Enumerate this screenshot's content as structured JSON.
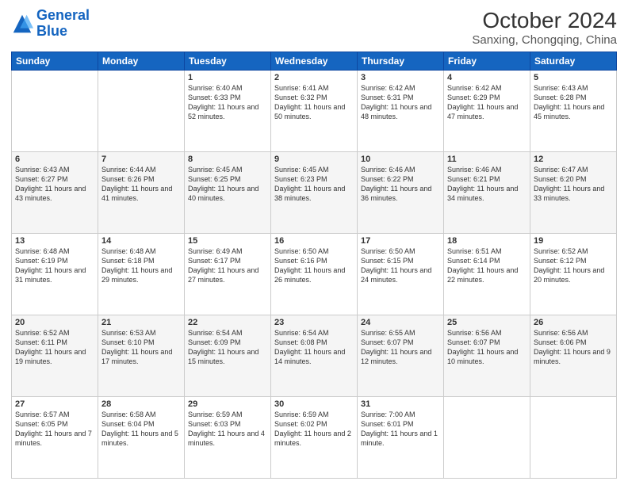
{
  "logo": {
    "line1": "General",
    "line2": "Blue"
  },
  "title": "October 2024",
  "subtitle": "Sanxing, Chongqing, China",
  "days": [
    "Sunday",
    "Monday",
    "Tuesday",
    "Wednesday",
    "Thursday",
    "Friday",
    "Saturday"
  ],
  "weeks": [
    [
      {
        "day": "",
        "content": ""
      },
      {
        "day": "",
        "content": ""
      },
      {
        "day": "1",
        "content": "Sunrise: 6:40 AM\nSunset: 6:33 PM\nDaylight: 11 hours and 52 minutes."
      },
      {
        "day": "2",
        "content": "Sunrise: 6:41 AM\nSunset: 6:32 PM\nDaylight: 11 hours and 50 minutes."
      },
      {
        "day": "3",
        "content": "Sunrise: 6:42 AM\nSunset: 6:31 PM\nDaylight: 11 hours and 48 minutes."
      },
      {
        "day": "4",
        "content": "Sunrise: 6:42 AM\nSunset: 6:29 PM\nDaylight: 11 hours and 47 minutes."
      },
      {
        "day": "5",
        "content": "Sunrise: 6:43 AM\nSunset: 6:28 PM\nDaylight: 11 hours and 45 minutes."
      }
    ],
    [
      {
        "day": "6",
        "content": "Sunrise: 6:43 AM\nSunset: 6:27 PM\nDaylight: 11 hours and 43 minutes."
      },
      {
        "day": "7",
        "content": "Sunrise: 6:44 AM\nSunset: 6:26 PM\nDaylight: 11 hours and 41 minutes."
      },
      {
        "day": "8",
        "content": "Sunrise: 6:45 AM\nSunset: 6:25 PM\nDaylight: 11 hours and 40 minutes."
      },
      {
        "day": "9",
        "content": "Sunrise: 6:45 AM\nSunset: 6:23 PM\nDaylight: 11 hours and 38 minutes."
      },
      {
        "day": "10",
        "content": "Sunrise: 6:46 AM\nSunset: 6:22 PM\nDaylight: 11 hours and 36 minutes."
      },
      {
        "day": "11",
        "content": "Sunrise: 6:46 AM\nSunset: 6:21 PM\nDaylight: 11 hours and 34 minutes."
      },
      {
        "day": "12",
        "content": "Sunrise: 6:47 AM\nSunset: 6:20 PM\nDaylight: 11 hours and 33 minutes."
      }
    ],
    [
      {
        "day": "13",
        "content": "Sunrise: 6:48 AM\nSunset: 6:19 PM\nDaylight: 11 hours and 31 minutes."
      },
      {
        "day": "14",
        "content": "Sunrise: 6:48 AM\nSunset: 6:18 PM\nDaylight: 11 hours and 29 minutes."
      },
      {
        "day": "15",
        "content": "Sunrise: 6:49 AM\nSunset: 6:17 PM\nDaylight: 11 hours and 27 minutes."
      },
      {
        "day": "16",
        "content": "Sunrise: 6:50 AM\nSunset: 6:16 PM\nDaylight: 11 hours and 26 minutes."
      },
      {
        "day": "17",
        "content": "Sunrise: 6:50 AM\nSunset: 6:15 PM\nDaylight: 11 hours and 24 minutes."
      },
      {
        "day": "18",
        "content": "Sunrise: 6:51 AM\nSunset: 6:14 PM\nDaylight: 11 hours and 22 minutes."
      },
      {
        "day": "19",
        "content": "Sunrise: 6:52 AM\nSunset: 6:12 PM\nDaylight: 11 hours and 20 minutes."
      }
    ],
    [
      {
        "day": "20",
        "content": "Sunrise: 6:52 AM\nSunset: 6:11 PM\nDaylight: 11 hours and 19 minutes."
      },
      {
        "day": "21",
        "content": "Sunrise: 6:53 AM\nSunset: 6:10 PM\nDaylight: 11 hours and 17 minutes."
      },
      {
        "day": "22",
        "content": "Sunrise: 6:54 AM\nSunset: 6:09 PM\nDaylight: 11 hours and 15 minutes."
      },
      {
        "day": "23",
        "content": "Sunrise: 6:54 AM\nSunset: 6:08 PM\nDaylight: 11 hours and 14 minutes."
      },
      {
        "day": "24",
        "content": "Sunrise: 6:55 AM\nSunset: 6:07 PM\nDaylight: 11 hours and 12 minutes."
      },
      {
        "day": "25",
        "content": "Sunrise: 6:56 AM\nSunset: 6:07 PM\nDaylight: 11 hours and 10 minutes."
      },
      {
        "day": "26",
        "content": "Sunrise: 6:56 AM\nSunset: 6:06 PM\nDaylight: 11 hours and 9 minutes."
      }
    ],
    [
      {
        "day": "27",
        "content": "Sunrise: 6:57 AM\nSunset: 6:05 PM\nDaylight: 11 hours and 7 minutes."
      },
      {
        "day": "28",
        "content": "Sunrise: 6:58 AM\nSunset: 6:04 PM\nDaylight: 11 hours and 5 minutes."
      },
      {
        "day": "29",
        "content": "Sunrise: 6:59 AM\nSunset: 6:03 PM\nDaylight: 11 hours and 4 minutes."
      },
      {
        "day": "30",
        "content": "Sunrise: 6:59 AM\nSunset: 6:02 PM\nDaylight: 11 hours and 2 minutes."
      },
      {
        "day": "31",
        "content": "Sunrise: 7:00 AM\nSunset: 6:01 PM\nDaylight: 11 hours and 1 minute."
      },
      {
        "day": "",
        "content": ""
      },
      {
        "day": "",
        "content": ""
      }
    ]
  ]
}
